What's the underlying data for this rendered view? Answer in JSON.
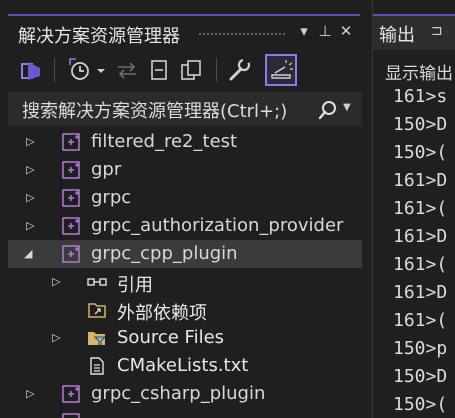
{
  "solution_explorer": {
    "title": "解决方案资源管理器",
    "title_buttons": [
      "▾",
      "⊥",
      "✕"
    ],
    "search_placeholder": "搜索解决方案资源管理器(Ctrl+;)",
    "tree": [
      {
        "label": "filtered_re2_test",
        "kind": "project",
        "expanded": false
      },
      {
        "label": "gpr",
        "kind": "project",
        "expanded": false
      },
      {
        "label": "grpc",
        "kind": "project",
        "expanded": false
      },
      {
        "label": "grpc_authorization_provider",
        "kind": "project",
        "expanded": false
      },
      {
        "label": "grpc_cpp_plugin",
        "kind": "project",
        "expanded": true,
        "selected": true
      },
      {
        "label": "引用",
        "kind": "references",
        "expanded": false
      },
      {
        "label": "外部依赖项",
        "kind": "external-deps"
      },
      {
        "label": "Source Files",
        "kind": "folder",
        "expanded": false
      },
      {
        "label": "CMakeLists.txt",
        "kind": "file"
      },
      {
        "label": "grpc_csharp_plugin",
        "kind": "project",
        "expanded": false
      }
    ]
  },
  "output": {
    "tab_label": "输出",
    "pin": "⊐",
    "show_output_label": "显示输出",
    "lines": [
      "161>s",
      "150>D",
      "150>(",
      "161>D",
      "161>(",
      "161>D",
      "161>(",
      "161>D",
      "161>(",
      "150>p",
      "150>D",
      "150>("
    ]
  },
  "colors": {
    "accent": "#8a7cf0",
    "project_icon": "#b47ad8",
    "folder": "#d7b46a"
  }
}
